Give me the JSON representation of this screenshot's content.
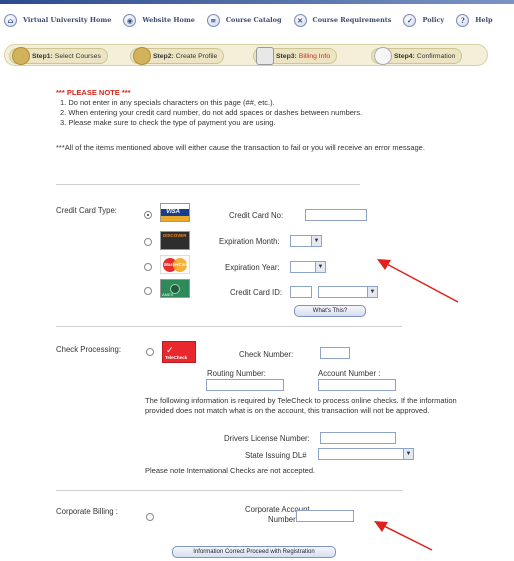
{
  "nav": {
    "items": [
      {
        "label": "Virtual University Home",
        "icon": "home-icon",
        "glyph": "⌂"
      },
      {
        "label": "Website Home",
        "icon": "globe-icon",
        "glyph": "◉"
      },
      {
        "label": "Course Catalog",
        "icon": "catalog-icon",
        "glyph": "≡"
      },
      {
        "label": "Course Requirements",
        "icon": "requirements-icon",
        "glyph": "✕"
      },
      {
        "label": "Policy",
        "icon": "policy-icon",
        "glyph": "✓"
      },
      {
        "label": "Help",
        "icon": "help-icon",
        "glyph": "?"
      }
    ]
  },
  "steps": [
    {
      "num": "Step1:",
      "label": " Select Courses"
    },
    {
      "num": "Step2:",
      "label": " Create Profile"
    },
    {
      "num": "Step3:",
      "label": " Billing Info"
    },
    {
      "num": "Step4:",
      "label": " Confirmation"
    }
  ],
  "note": {
    "title": "*** PLEASE NOTE ***",
    "items": [
      "1.   Do not enter in any specials characters on this page (##, etc.).",
      "2.   When entering your credit card number, do not add spaces or dashes between numbers.",
      "3.   Please make sure to check the type of payment you are using."
    ],
    "footer": "***All of the items mentioned above will either cause the transaction to fail or you will receive an error message."
  },
  "credit": {
    "section_label": "Credit Card Type:",
    "cards": [
      "VISA",
      "DISCOVER",
      "MasterCard",
      "AMEX"
    ],
    "card_no_label": "Credit Card No:",
    "exp_month_label": "Expiration Month:",
    "exp_year_label": "Expiration Year:",
    "card_id_label": "Credit Card ID:",
    "whats_this": "What's This?"
  },
  "check": {
    "section_label": "Check Processing:",
    "logo": "TeleCheck",
    "check_number_label": "Check Number:",
    "routing_label": "Routing Number:",
    "account_label": "Account Number :",
    "info": "The following information is required by TeleCheck to process online checks. If the information provided does not match what is on the account, this transaction will not be approved.",
    "dl_label": "Drivers License Number:",
    "state_label": "State Issuing DL#",
    "intl_note": "Please note International Checks are not accepted."
  },
  "corporate": {
    "section_label": "Corporate Billing :",
    "account_label_1": "Corporate Account",
    "account_label_2": "Number:"
  },
  "submit_label": "Information Correct Proceed with Registration",
  "colors": {
    "accent_red": "#d1271b",
    "input_border": "#8da3c9"
  }
}
